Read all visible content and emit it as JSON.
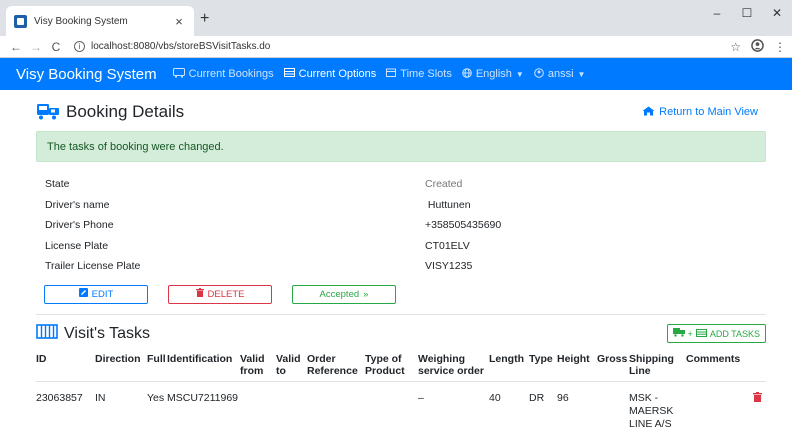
{
  "browser": {
    "tab_title": "Visy Booking System",
    "tab_close": "×",
    "new_tab": "+",
    "url": "localhost:8080/vbs/storeBSVisitTasks.do",
    "win_min": "–",
    "win_max": "☐",
    "win_close": "✕",
    "back": "←",
    "forward": "→",
    "reload": "C",
    "star": "☆",
    "menu": "⋮"
  },
  "navbar": {
    "brand": "Visy Booking System",
    "items": [
      {
        "label": "Current Bookings",
        "active": false
      },
      {
        "label": "Current Options",
        "active": true
      },
      {
        "label": "Time Slots",
        "active": false
      },
      {
        "label": "English",
        "active": false
      },
      {
        "label": "anssi",
        "active": false
      }
    ]
  },
  "booking": {
    "title": "Booking Details",
    "return_label": "Return to Main View",
    "alert": "The tasks of booking were changed.",
    "fields": [
      {
        "label": "State",
        "value": "Created",
        "muted": true
      },
      {
        "label": "Driver's name",
        "value": " Huttunen",
        "muted": false
      },
      {
        "label": "Driver's Phone",
        "value": "+358505435690",
        "muted": false
      },
      {
        "label": "License Plate",
        "value": "CT01ELV",
        "muted": false
      },
      {
        "label": "Trailer License Plate",
        "value": "VISY1235",
        "muted": false
      }
    ],
    "edit_label": "EDIT",
    "delete_label": "DELETE",
    "accepted_label": "Accepted",
    "accepted_suffix": "»"
  },
  "tasks": {
    "title": "Visit's Tasks",
    "add_label": "ADD TASKS",
    "add_plus": "+",
    "columns": [
      "ID",
      "Direction",
      "Full",
      "Identification",
      "Valid from",
      "Valid to",
      "Order Reference",
      "Type of Product",
      "Weighing service order",
      "Length",
      "Type",
      "Height",
      "Gross",
      "Shipping Line",
      "Comments"
    ],
    "rows": [
      {
        "id": "23063857",
        "direction": "IN",
        "full": "Yes",
        "identification": "MSCU7211969",
        "valid_from": "",
        "valid_to": "",
        "order_reference": "",
        "type_of_product": "",
        "weighing": "–",
        "length": "40",
        "type": "DR",
        "height": "96",
        "gross": "",
        "shipping_line": "MSK - MAERSK LINE A/S",
        "comments": ""
      }
    ]
  },
  "colors": {
    "primary": "#007bff",
    "danger": "#dc3545",
    "success": "#28a745",
    "alert_bg": "#d4edda"
  }
}
